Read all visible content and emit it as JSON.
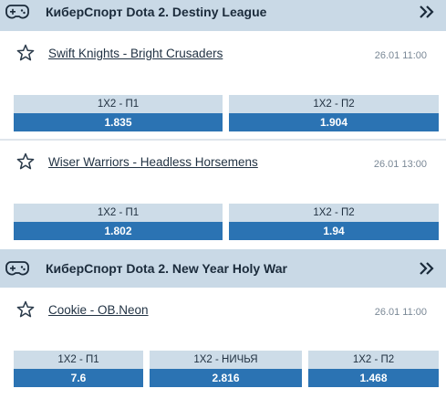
{
  "leagues": [
    {
      "title": "КиберСпорт Dota 2. Destiny League",
      "matches": [
        {
          "teams": "Swift Knights - Bright Crusaders",
          "time": "26.01 11:00",
          "odds": [
            {
              "label": "1X2 - П1",
              "value": "1.835"
            },
            {
              "label": "1X2 - П2",
              "value": "1.904"
            }
          ]
        },
        {
          "teams": "Wiser Warriors - Headless Horsemens",
          "time": "26.01 13:00",
          "odds": [
            {
              "label": "1X2 - П1",
              "value": "1.802"
            },
            {
              "label": "1X2 - П2",
              "value": "1.94"
            }
          ]
        }
      ]
    },
    {
      "title": "КиберСпорт Dota 2. New Year Holy War",
      "matches": [
        {
          "teams": "Cookie - OB.Neon",
          "time": "26.01 11:00",
          "odds": [
            {
              "label": "1X2 - П1",
              "value": "7.6"
            },
            {
              "label": "1X2 - НИЧЬЯ",
              "value": "2.816"
            },
            {
              "label": "1X2 - П2",
              "value": "1.468"
            }
          ]
        }
      ]
    }
  ],
  "icons": {
    "league": "gamepad-icon",
    "expand": "double-chevron-right-icon",
    "favorite": "star-outline-icon"
  },
  "colors": {
    "header_bg": "#c9d9e6",
    "odd_label_bg": "#cddce8",
    "odd_value_bg": "#2b73b3"
  }
}
